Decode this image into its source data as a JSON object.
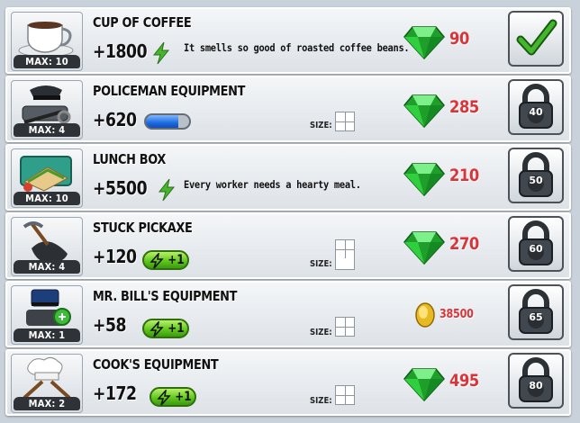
{
  "items": [
    {
      "name": "CUP OF COFFEE",
      "max": "MAX: 10",
      "bonus": "+1800",
      "bonus_kind": "energy",
      "description": "It smells so good of roasted coffee beans.",
      "currency": "gem",
      "price": "90",
      "action": "check",
      "thumb_icon": "coffee-cup-icon"
    },
    {
      "name": "POLICEMAN EQUIPMENT",
      "max": "MAX: 4",
      "bonus": "+620",
      "bonus_kind": "stamina-bar",
      "size_label": "SIZE:",
      "currency": "gem",
      "price": "285",
      "action": "lock",
      "lock_level": "40",
      "thumb_icon": "police-gear-icon"
    },
    {
      "name": "LUNCH BOX",
      "max": "MAX: 10",
      "bonus": "+5500",
      "bonus_kind": "energy",
      "description": "Every worker needs a hearty meal.",
      "currency": "gem",
      "price": "210",
      "action": "lock",
      "lock_level": "50",
      "thumb_icon": "lunch-box-icon"
    },
    {
      "name": "STUCK PICKAXE",
      "max": "MAX: 4",
      "bonus": "+120",
      "bonus_kind": "energy-plus",
      "plus_label": "+1",
      "size_label": "SIZE:",
      "currency": "gem",
      "price": "270",
      "action": "lock",
      "lock_level": "60",
      "thumb_icon": "pickaxe-icon"
    },
    {
      "name": "MR. BILL'S EQUIPMENT",
      "max": "MAX: 1",
      "bonus": "+58",
      "bonus_kind": "energy-plus",
      "plus_label": "+1",
      "size_label": "SIZE:",
      "currency": "coin",
      "price": "38500",
      "action": "lock",
      "lock_level": "65",
      "thumb_icon": "mr-bill-gear-icon"
    },
    {
      "name": "COOK'S EQUIPMENT",
      "max": "MAX: 2",
      "bonus": "+172",
      "bonus_kind": "energy-plus",
      "plus_label": "+1",
      "size_label": "SIZE:",
      "currency": "gem",
      "price": "495",
      "action": "lock",
      "lock_level": "80",
      "thumb_icon": "cook-gear-icon"
    }
  ],
  "colors": {
    "price_red": "#d8343a",
    "gem_green": "#2fbf3a",
    "bolt_green": "#3fae2a",
    "check_green": "#2e9b1e"
  }
}
